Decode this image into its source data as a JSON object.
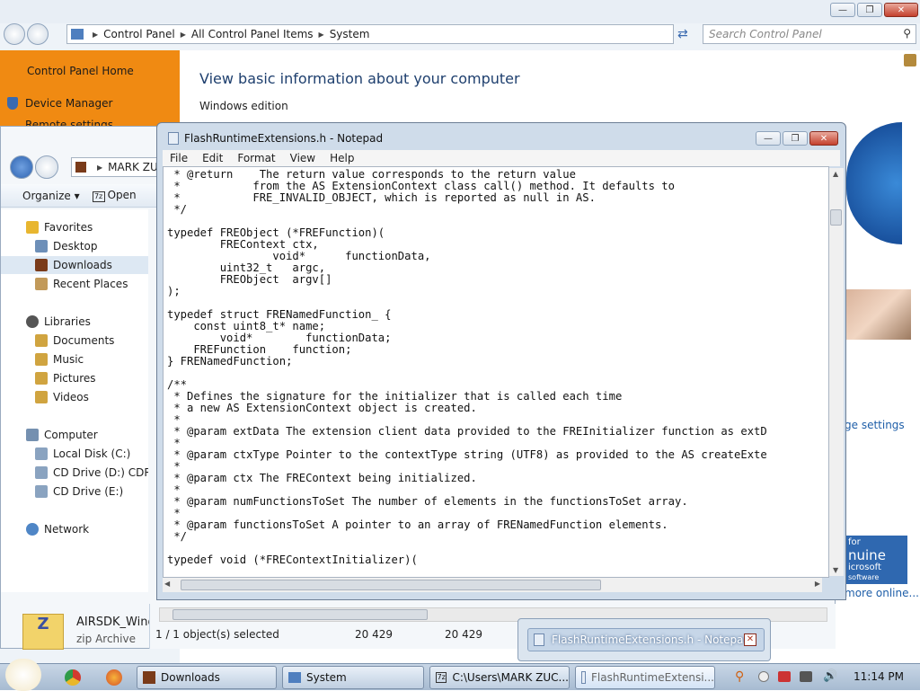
{
  "control_panel": {
    "address": [
      "Control Panel",
      "All Control Panel Items",
      "System"
    ],
    "search_placeholder": "Search Control Panel",
    "sidebar": {
      "home": "Control Panel Home",
      "device_manager": "Device Manager",
      "remote": "Remote settings"
    },
    "heading": "View basic information about your computer",
    "section": "Windows edition",
    "change_settings": "ge settings",
    "genuine_line1": "for",
    "genuine_line2": "nuine",
    "genuine_line3": "icrosoft",
    "genuine_line4": "software",
    "more_online": "more online..."
  },
  "explorer": {
    "address": "MARK ZUC",
    "toolbar": {
      "organize": "Organize",
      "open": "Open"
    },
    "tree": {
      "favorites": "Favorites",
      "desktop": "Desktop",
      "downloads": "Downloads",
      "recent": "Recent Places",
      "libraries": "Libraries",
      "documents": "Documents",
      "music": "Music",
      "pictures": "Pictures",
      "videos": "Videos",
      "computer": "Computer",
      "local_disk": "Local Disk (C:)",
      "cd_d": "CD Drive (D:) CDRO",
      "cd_e": "CD Drive (E:)",
      "network": "Network"
    },
    "file": {
      "name": "AIRSDK_Wind",
      "type": "zip Archive"
    },
    "status": {
      "selected": "1 / 1 object(s) selected",
      "size1": "20 429",
      "size2": "20 429"
    }
  },
  "notepad": {
    "title": "FlashRuntimeExtensions.h - Notepad",
    "menu": [
      "File",
      "Edit",
      "Format",
      "View",
      "Help"
    ],
    "code": " * @return    The return value corresponds to the return value\n *           from the AS ExtensionContext class call() method. It defaults to\n *           FRE_INVALID_OBJECT, which is reported as null in AS.\n */\n\ntypedef FREObject (*FREFunction)(\n        FREContext ctx,\n                void*      functionData,\n        uint32_t   argc,\n        FREObject  argv[]\n);\n\ntypedef struct FRENamedFunction_ {\n    const uint8_t* name;\n        void*        functionData;\n    FREFunction    function;\n} FRENamedFunction;\n\n/**\n * Defines the signature for the initializer that is called each time\n * a new AS ExtensionContext object is created.\n *\n * @param extData The extension client data provided to the FREInitializer function as extD\n *\n * @param ctxType Pointer to the contextType string (UTF8) as provided to the AS createExte\n *\n * @param ctx The FREContext being initialized.\n *\n * @param numFunctionsToSet The number of elements in the functionsToSet array.\n *\n * @param functionsToSet A pointer to an array of FRENamedFunction elements.\n */\n\ntypedef void (*FREContextInitializer)("
  },
  "preview": {
    "title": "FlashRuntimeExtensions.h - Notepad"
  },
  "taskbar": {
    "downloads": "Downloads",
    "system": "System",
    "cmd": "C:\\Users\\MARK ZUC...",
    "notepad": "FlashRuntimeExtensi...",
    "clock": "11:14 PM"
  },
  "colors": {
    "accent": "#f08a12",
    "link": "#1e5ea8"
  }
}
